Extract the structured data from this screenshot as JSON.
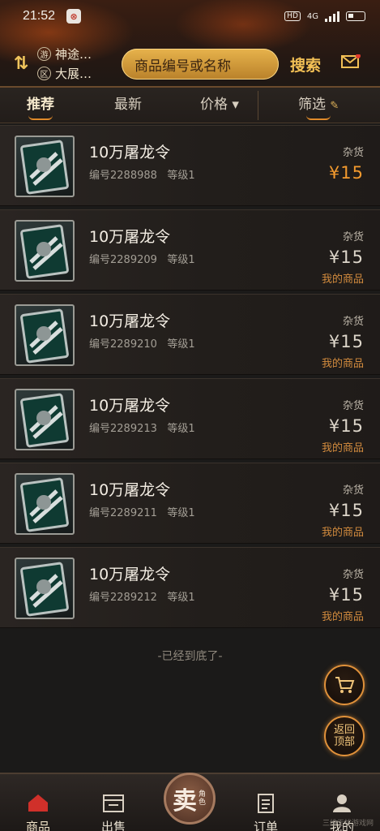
{
  "status_bar": {
    "time": "21:52",
    "app_badge": "⊗",
    "hd_label": "HD",
    "network_label": "4G"
  },
  "header": {
    "switch_icon": "switch-arrows-icon",
    "game_badge": "游",
    "game_name": "神途…",
    "server_badge": "区",
    "server_name": "大展…",
    "search_placeholder": "商品编号或名称",
    "search_button": "搜索",
    "mail_icon": "mail-icon"
  },
  "tabs": [
    {
      "label": "推荐",
      "active": true
    },
    {
      "label": "最新",
      "active": false
    },
    {
      "label": "价格 ▾",
      "active": false
    },
    {
      "label": "筛选",
      "active": false
    }
  ],
  "items": [
    {
      "name": "10万屠龙令",
      "code": "编号2288988",
      "level": "等级1",
      "category": "杂货",
      "price": "¥15",
      "mine": ""
    },
    {
      "name": "10万屠龙令",
      "code": "编号2289209",
      "level": "等级1",
      "category": "杂货",
      "price": "¥15",
      "mine": "我的商品"
    },
    {
      "name": "10万屠龙令",
      "code": "编号2289210",
      "level": "等级1",
      "category": "杂货",
      "price": "¥15",
      "mine": "我的商品"
    },
    {
      "name": "10万屠龙令",
      "code": "编号2289213",
      "level": "等级1",
      "category": "杂货",
      "price": "¥15",
      "mine": "我的商品"
    },
    {
      "name": "10万屠龙令",
      "code": "编号2289211",
      "level": "等级1",
      "category": "杂货",
      "price": "¥15",
      "mine": "我的商品"
    },
    {
      "name": "10万屠龙令",
      "code": "编号2289212",
      "level": "等级1",
      "category": "杂货",
      "price": "¥15",
      "mine": "我的商品"
    }
  ],
  "end_text": "-已经到底了-",
  "floating": {
    "cart_icon": "cart-icon",
    "back_to_top_line1": "返回",
    "back_to_top_line2": "顶部"
  },
  "bottom_nav": {
    "home": "商品",
    "sell_list": "出售",
    "sell_center_big": "卖",
    "sell_center_small": "角色",
    "orders": "订单",
    "mine": "我的"
  },
  "watermark": "三维无忧游戏网",
  "colors": {
    "accent": "#f39a2e",
    "gold": "#e7b34c",
    "mine_text": "#d28b3e"
  }
}
